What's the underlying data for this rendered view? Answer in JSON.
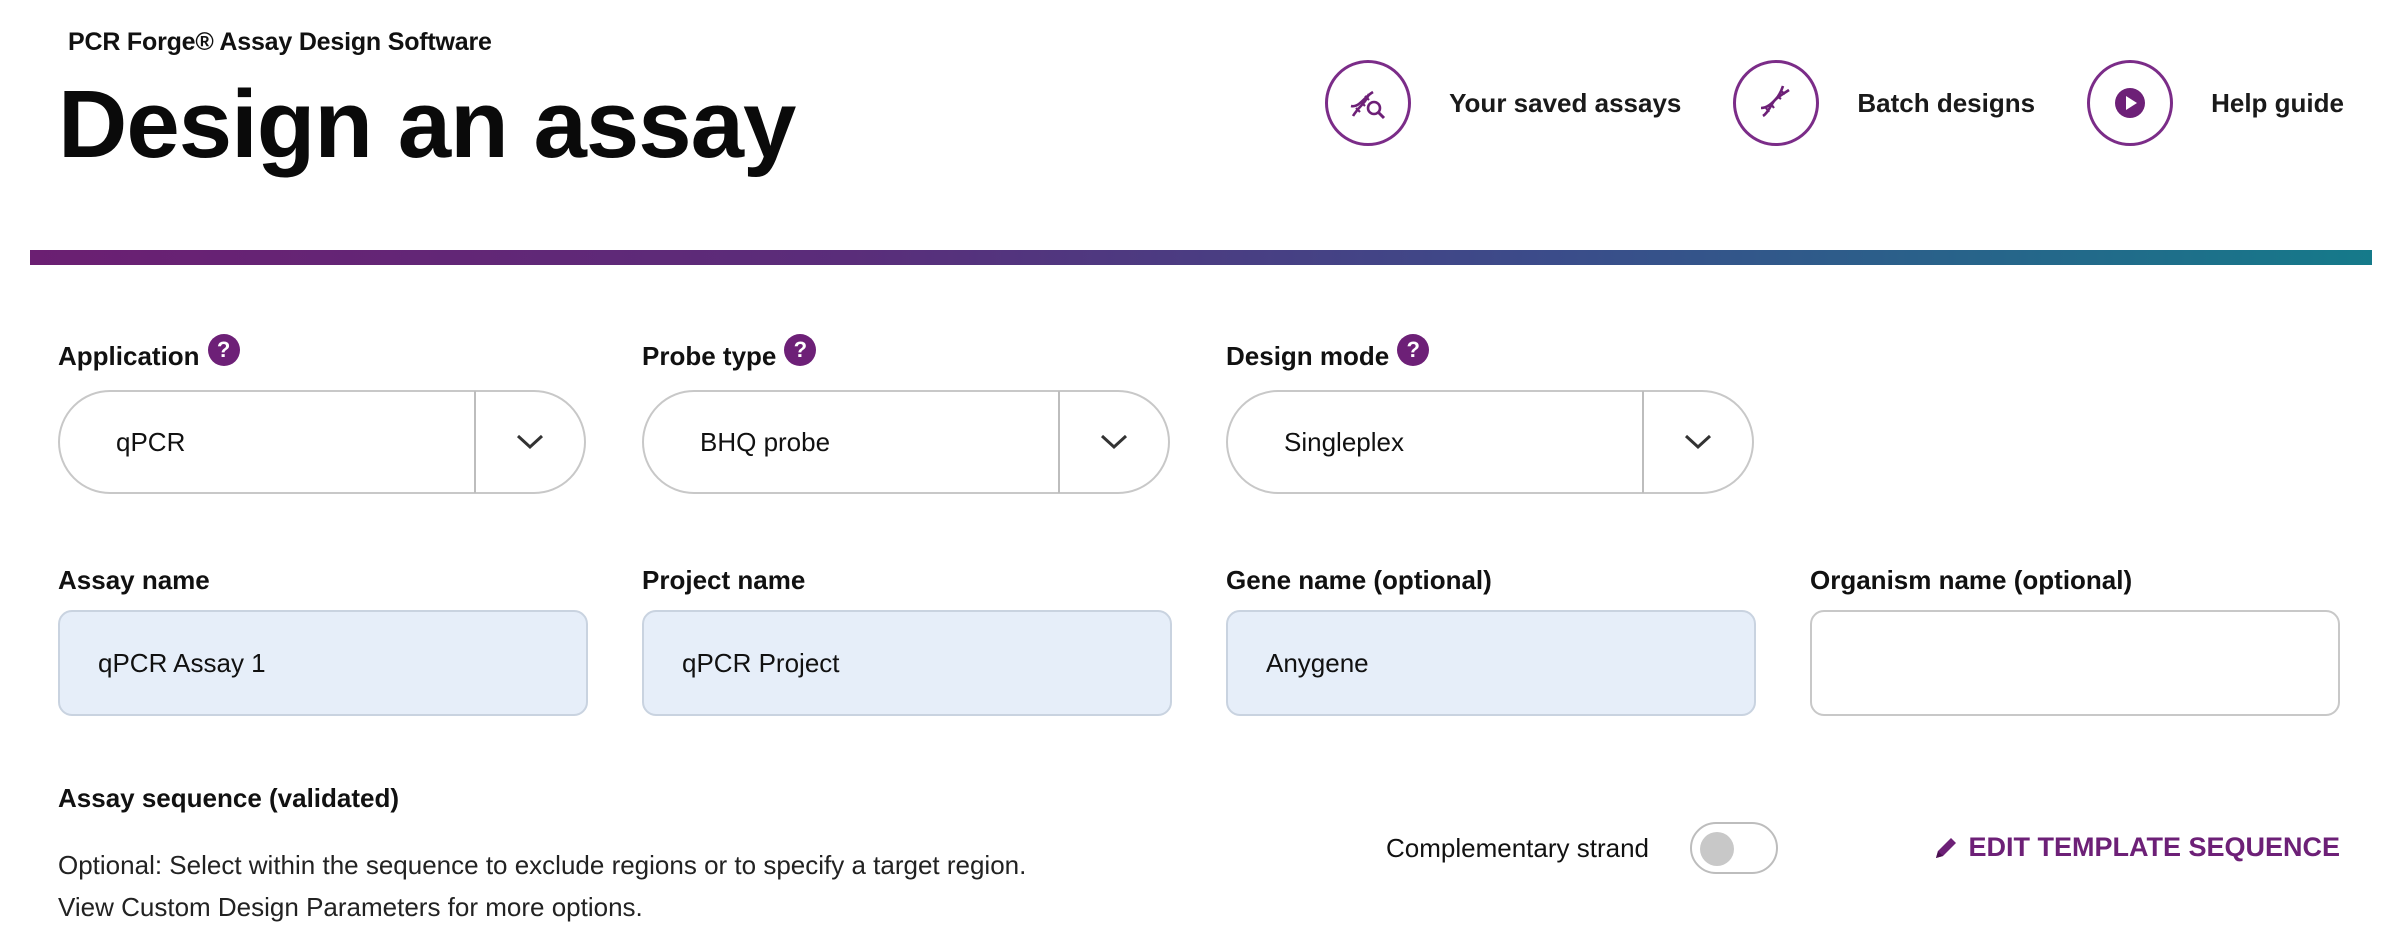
{
  "header": {
    "app_name": "PCR Forge® Assay Design Software",
    "page_title": "Design an assay"
  },
  "top_nav": [
    {
      "label": "Your saved assays",
      "icon": "dna-search-icon"
    },
    {
      "label": "Batch designs",
      "icon": "dna-icon"
    },
    {
      "label": "Help guide",
      "icon": "play-icon"
    }
  ],
  "colors": {
    "accent": "#6d2077",
    "input_filled_bg": "#e6eef9",
    "gradient_start": "#6b1f72",
    "gradient_end": "#157a8a"
  },
  "form": {
    "application": {
      "label": "Application",
      "value": "qPCR",
      "help": "?"
    },
    "probe_type": {
      "label": "Probe type",
      "value": "BHQ probe",
      "help": "?"
    },
    "design_mode": {
      "label": "Design mode",
      "value": "Singleplex",
      "help": "?"
    },
    "assay_name": {
      "label": "Assay name",
      "value": "qPCR Assay 1"
    },
    "project_name": {
      "label": "Project name",
      "value": "qPCR Project"
    },
    "gene_name": {
      "label": "Gene name (optional)",
      "value": "Anygene"
    },
    "organism_name": {
      "label": "Organism name (optional)",
      "value": ""
    }
  },
  "sequence": {
    "title": "Assay sequence (validated)",
    "hint_line1": "Optional: Select within the sequence to exclude regions or to specify a target region.",
    "hint_line2": "View Custom Design Parameters for more options.",
    "toggle_label": "Complementary strand",
    "toggle_on": false,
    "edit_label": "EDIT TEMPLATE SEQUENCE"
  }
}
